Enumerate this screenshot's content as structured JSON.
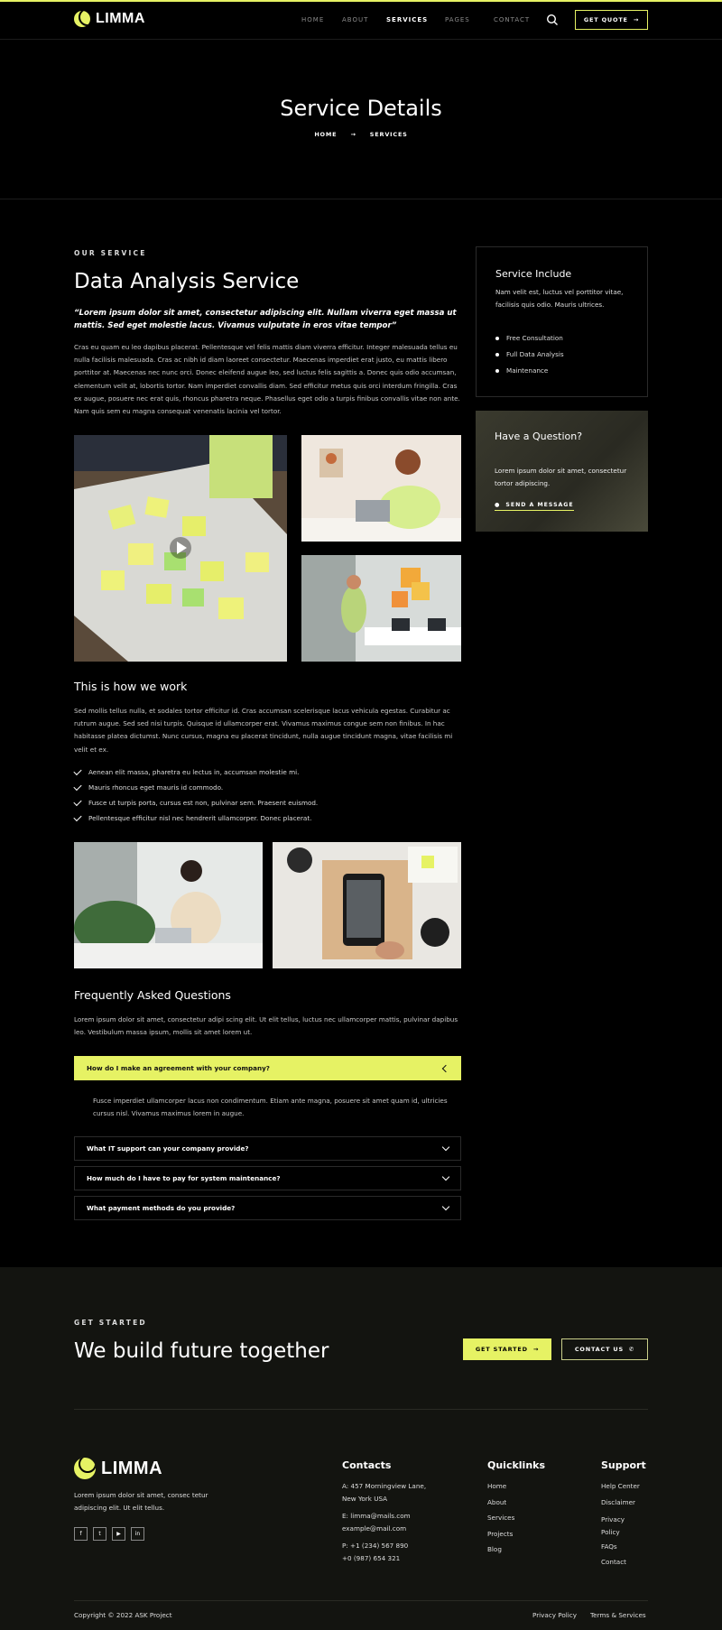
{
  "header": {
    "brand": "LIMMA",
    "nav": [
      "HOME",
      "ABOUT",
      "SERVICES",
      "PAGES",
      "CONTACT"
    ],
    "active_nav": "SERVICES",
    "cta_label": "GET QUOTE",
    "accent_color": "#e6f264"
  },
  "hero": {
    "title": "Service Details",
    "breadcrumb": [
      "HOME",
      "SERVICES"
    ]
  },
  "main": {
    "eyebrow": "OUR SERVICE",
    "title": "Data Analysis Service",
    "quote": "“Lorem ipsum dolor sit amet, consectetur adipiscing elit. Nullam viverra eget massa ut mattis. Sed eget molestie lacus. Vivamus vulputate in eros vitae tempor”",
    "intro": "Cras eu quam eu leo dapibus placerat. Pellentesque vel felis mattis diam viverra efficitur. Integer malesuada tellus eu nulla facilisis malesuada. Cras ac nibh id diam laoreet consectetur. Maecenas imperdiet erat justo, eu mattis libero porttitor at. Maecenas nec nunc orci. Donec eleifend augue leo, sed luctus felis sagittis a. Donec quis odio accumsan, elementum velit at, lobortis tortor. Nam imperdiet convallis diam. Sed efficitur metus quis orci interdum fringilla. Cras ex augue, posuere nec erat quis, rhoncus pharetra neque. Phasellus eget odio a turpis finibus convallis vitae non ante. Nam quis sem eu magna consequat venenatis lacinia vel tortor.",
    "work_title": "This is how we work",
    "work_text": "Sed mollis tellus nulla, et sodales tortor efficitur id. Cras accumsan scelerisque lacus vehicula egestas. Curabitur ac rutrum augue. Sed sed nisi turpis. Quisque id ullamcorper erat. Vivamus maximus congue sem non finibus. In hac habitasse platea dictumst. Nunc cursus, magna eu placerat tincidunt, nulla augue tincidunt magna, vitae facilisis mi velit et ex.",
    "checklist": [
      "Aenean elit massa, pharetra eu lectus in, accumsan molestie mi.",
      "Mauris rhoncus eget mauris id commodo.",
      "Fusce ut turpis porta, cursus est non, pulvinar sem. Praesent euismod.",
      "Pellentesque efficitur nisl nec hendrerit ullamcorper. Donec placerat."
    ],
    "faq_title": "Frequently Asked Questions",
    "faq_intro": "Lorem ipsum dolor sit amet, consectetur adipi scing elit. Ut elit tellus, luctus nec ullamcorper mattis, pulvinar dapibus leo. Vestibulum massa ipsum, mollis sit amet lorem ut.",
    "faqs": [
      {
        "q": "How do I make an agreement with your company?",
        "a": "Fusce imperdiet ullamcorper lacus non condimentum. Etiam ante magna, posuere sit amet quam id, ultricies cursus nisl. Vivamus maximus lorem in augue."
      },
      {
        "q": "What IT support can your company provide?"
      },
      {
        "q": "How much do I have to pay for system maintenance?"
      },
      {
        "q": "What payment methods do you provide?"
      }
    ]
  },
  "sidebar": {
    "include_title": "Service Include",
    "include_text": "Nam velit est, luctus vel porttitor vitae, facilisis quis odio. Mauris ultrices.",
    "include_items": [
      "Free Consultation",
      "Full Data Analysis",
      "Maintenance"
    ],
    "question_title": "Have a Question?",
    "question_text": "Lorem ipsum dolor sit amet, consectetur tortor adipiscing.",
    "question_link": "SEND A MESSAGE"
  },
  "cta": {
    "eyebrow": "GET STARTED",
    "title": "We build future together",
    "primary": "GET STARTED",
    "secondary": "CONTACT US"
  },
  "footer": {
    "brand": "LIMMA",
    "about": "Lorem ipsum dolor sit amet, consec tetur adipiscing elit. Ut elit tellus.",
    "contacts_title": "Contacts",
    "address": [
      "A: 457 Morningview Lane,",
      "New York USA"
    ],
    "emails": [
      "E: limma@mails.com",
      "example@mail.com"
    ],
    "phones": [
      "P: +1 (234) 567 890",
      "+0 (987) 654 321"
    ],
    "quicklinks_title": "Quicklinks",
    "quicklinks": [
      "Home",
      "About",
      "Services",
      "Projects",
      "Blog"
    ],
    "support_title": "Support",
    "support": [
      "Help Center",
      "Disclaimer",
      "Privacy Policy",
      "FAQs",
      "Contact"
    ],
    "copyright": "Copyright © 2022 ASK Project",
    "legal": [
      "Privacy Policy",
      "Terms & Services"
    ]
  }
}
